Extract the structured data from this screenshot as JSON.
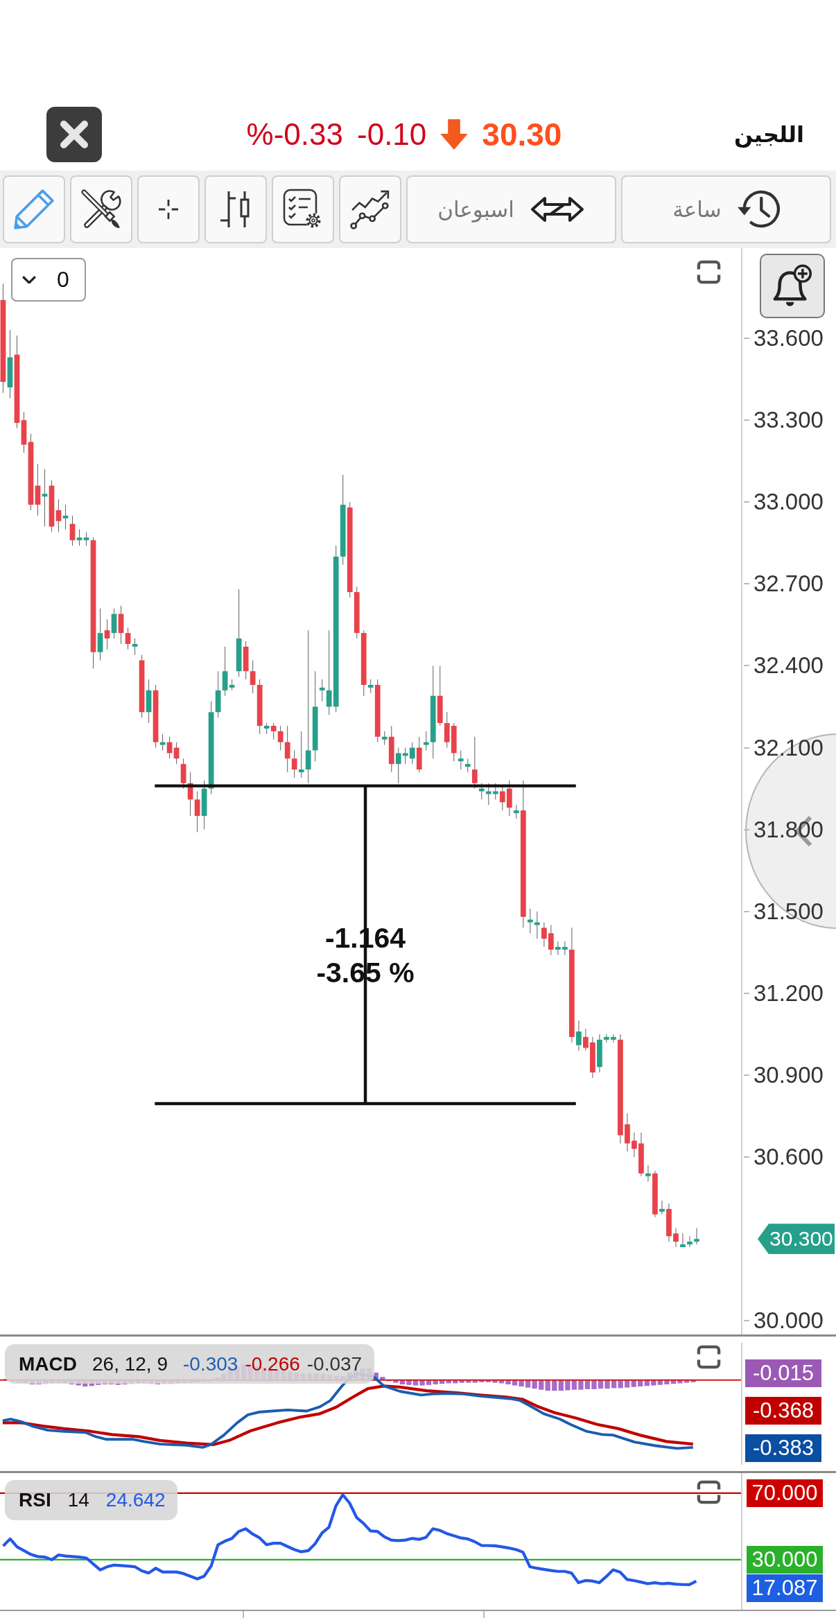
{
  "header": {
    "symbol": "اللجين",
    "price": "30.30",
    "falling": true,
    "change": "-0.10",
    "change_percent": "%-0.33"
  },
  "toolbar": {
    "period_button": {
      "label": "اسبوعان"
    },
    "interval_button": {
      "label": "ساعة"
    }
  },
  "chart": {
    "layer_selector": {
      "value": "0"
    },
    "last_price_tag": "30.300",
    "measurement": {
      "change": "-1.164",
      "change_percent": "-3.65 %"
    },
    "chart_data": {
      "type": "candlestick",
      "ylim": [
        29.95,
        33.93
      ],
      "yticks": [
        {
          "value": 33.6,
          "label": "33.600"
        },
        {
          "value": 33.3,
          "label": "33.300"
        },
        {
          "value": 33.0,
          "label": "33.000"
        },
        {
          "value": 32.7,
          "label": "32.700"
        },
        {
          "value": 32.4,
          "label": "32.400"
        },
        {
          "value": 32.1,
          "label": "32.100"
        },
        {
          "value": 31.8,
          "label": "31.800"
        },
        {
          "value": 31.5,
          "label": "31.500"
        },
        {
          "value": 31.2,
          "label": "31.200"
        },
        {
          "value": 30.9,
          "label": "30.900"
        },
        {
          "value": 30.6,
          "label": "30.600"
        },
        {
          "value": 30.0,
          "label": "30.000"
        }
      ],
      "ohlc": [
        [
          33.74,
          33.8,
          33.4,
          33.44
        ],
        [
          33.42,
          33.63,
          33.38,
          33.53
        ],
        [
          33.54,
          33.61,
          33.27,
          33.29
        ],
        [
          33.3,
          33.33,
          33.18,
          33.21
        ],
        [
          33.22,
          33.25,
          32.97,
          32.99
        ],
        [
          33.06,
          33.14,
          32.95,
          32.99
        ],
        [
          33.02,
          33.12,
          32.91,
          33.03
        ],
        [
          33.06,
          33.08,
          32.89,
          32.91
        ],
        [
          32.97,
          33.01,
          32.89,
          32.93
        ],
        [
          32.94,
          32.99,
          32.9,
          32.95
        ],
        [
          32.92,
          32.95,
          32.84,
          32.86
        ],
        [
          32.86,
          32.9,
          32.84,
          32.87
        ],
        [
          32.86,
          32.89,
          32.84,
          32.87
        ],
        [
          32.86,
          32.87,
          32.39,
          32.45
        ],
        [
          32.45,
          32.61,
          32.42,
          32.52
        ],
        [
          32.53,
          32.57,
          32.46,
          32.5
        ],
        [
          32.52,
          32.61,
          32.5,
          32.59
        ],
        [
          32.59,
          32.62,
          32.48,
          32.52
        ],
        [
          32.52,
          32.54,
          32.46,
          32.48
        ],
        [
          32.47,
          32.5,
          32.44,
          32.48
        ],
        [
          32.42,
          32.44,
          32.21,
          32.23
        ],
        [
          32.23,
          32.35,
          32.19,
          32.31
        ],
        [
          32.31,
          32.33,
          32.1,
          32.12
        ],
        [
          32.11,
          32.15,
          32.09,
          32.12
        ],
        [
          32.12,
          32.14,
          32.06,
          32.08
        ],
        [
          32.1,
          32.12,
          32.04,
          32.06
        ],
        [
          32.04,
          32.06,
          31.95,
          31.97
        ],
        [
          31.97,
          32.01,
          31.85,
          31.91
        ],
        [
          31.91,
          31.94,
          31.79,
          31.85
        ],
        [
          31.85,
          31.98,
          31.8,
          31.95
        ],
        [
          31.95,
          32.27,
          31.93,
          32.23
        ],
        [
          32.23,
          32.38,
          32.21,
          32.31
        ],
        [
          32.31,
          32.47,
          32.29,
          32.38
        ],
        [
          32.32,
          32.35,
          32.31,
          32.33
        ],
        [
          32.38,
          32.68,
          32.36,
          32.5
        ],
        [
          32.47,
          32.49,
          32.35,
          32.38
        ],
        [
          32.38,
          32.42,
          32.3,
          32.33
        ],
        [
          32.33,
          32.35,
          32.15,
          32.18
        ],
        [
          32.17,
          32.19,
          32.15,
          32.18
        ],
        [
          32.18,
          32.19,
          32.13,
          32.16
        ],
        [
          32.16,
          32.18,
          32.09,
          32.12
        ],
        [
          32.12,
          32.18,
          32.01,
          32.06
        ],
        [
          32.06,
          32.09,
          31.99,
          32.02
        ],
        [
          32.01,
          32.16,
          31.99,
          32.02
        ],
        [
          32.02,
          32.53,
          31.97,
          32.09
        ],
        [
          32.09,
          32.38,
          32.05,
          32.25
        ],
        [
          32.31,
          32.35,
          32.27,
          32.32
        ],
        [
          32.25,
          32.53,
          32.22,
          32.31
        ],
        [
          32.25,
          32.84,
          32.23,
          32.8
        ],
        [
          32.8,
          33.1,
          32.77,
          32.99
        ],
        [
          32.98,
          33.0,
          32.65,
          32.67
        ],
        [
          32.67,
          32.69,
          32.5,
          32.52
        ],
        [
          32.52,
          32.53,
          32.29,
          32.33
        ],
        [
          32.32,
          32.35,
          32.3,
          32.33
        ],
        [
          32.33,
          32.35,
          32.12,
          32.14
        ],
        [
          32.13,
          32.16,
          32.11,
          32.14
        ],
        [
          32.14,
          32.18,
          32.01,
          32.04
        ],
        [
          32.04,
          32.1,
          31.97,
          32.08
        ],
        [
          32.07,
          32.1,
          32.04,
          32.08
        ],
        [
          32.06,
          32.12,
          32.04,
          32.1
        ],
        [
          32.1,
          32.14,
          32.01,
          32.02
        ],
        [
          32.11,
          32.16,
          32.09,
          32.12
        ],
        [
          32.12,
          32.4,
          32.06,
          32.29
        ],
        [
          32.29,
          32.4,
          32.18,
          32.19
        ],
        [
          32.19,
          32.23,
          32.1,
          32.12
        ],
        [
          32.18,
          32.19,
          32.05,
          32.08
        ],
        [
          32.05,
          32.09,
          32.02,
          32.06
        ],
        [
          32.03,
          32.06,
          32.01,
          32.04
        ],
        [
          32.02,
          32.14,
          31.95,
          31.97
        ],
        [
          31.94,
          31.97,
          31.91,
          31.95
        ],
        [
          31.93,
          31.97,
          31.89,
          31.94
        ],
        [
          31.93,
          31.97,
          31.91,
          31.94
        ],
        [
          31.94,
          31.96,
          31.87,
          31.9
        ],
        [
          31.95,
          31.98,
          31.85,
          31.88
        ],
        [
          31.86,
          31.89,
          31.84,
          31.87
        ],
        [
          31.87,
          31.98,
          31.44,
          31.48
        ],
        [
          31.46,
          31.51,
          31.42,
          31.47
        ],
        [
          31.45,
          31.5,
          31.4,
          31.46
        ],
        [
          31.44,
          31.46,
          31.37,
          31.4
        ],
        [
          31.42,
          31.45,
          31.34,
          31.36
        ],
        [
          31.36,
          31.39,
          31.34,
          31.37
        ],
        [
          31.36,
          31.39,
          31.34,
          31.37
        ],
        [
          31.36,
          31.44,
          31.02,
          31.04
        ],
        [
          31.01,
          31.1,
          30.99,
          31.06
        ],
        [
          31.04,
          31.07,
          30.99,
          31.0
        ],
        [
          31.02,
          31.04,
          30.89,
          30.91
        ],
        [
          30.93,
          31.05,
          30.91,
          31.03
        ],
        [
          31.03,
          31.05,
          31.02,
          31.04
        ],
        [
          31.03,
          31.05,
          31.02,
          31.04
        ],
        [
          31.03,
          31.05,
          30.65,
          30.68
        ],
        [
          30.72,
          30.76,
          30.62,
          30.65
        ],
        [
          30.66,
          30.69,
          30.6,
          30.63
        ],
        [
          30.65,
          30.69,
          30.53,
          30.54
        ],
        [
          30.53,
          30.57,
          30.51,
          30.54
        ],
        [
          30.54,
          30.55,
          30.38,
          30.39
        ],
        [
          30.4,
          30.44,
          30.39,
          30.41
        ],
        [
          30.41,
          30.43,
          30.29,
          30.31
        ],
        [
          30.32,
          30.34,
          30.27,
          30.29
        ],
        [
          30.27,
          30.32,
          30.27,
          30.28
        ],
        [
          30.28,
          30.31,
          30.27,
          30.29
        ],
        [
          30.29,
          30.34,
          30.28,
          30.3
        ]
      ],
      "ref_lines": [
        {
          "axis": "y",
          "value": 31.96,
          "color": "#111111"
        },
        {
          "axis": "y",
          "value": 30.796,
          "color": "#111111"
        }
      ]
    }
  },
  "macd": {
    "name": "MACD",
    "params": "26, 12, 9",
    "values": [
      {
        "text": "-0.303",
        "color": "#1f5fb4"
      },
      {
        "text": "-0.266",
        "color": "#c00000"
      },
      {
        "text": "-0.037",
        "color": "#333333"
      }
    ],
    "tags": [
      {
        "text": "-0.015",
        "color": "#9b59b6"
      },
      {
        "text": "-0.368",
        "color": "#c00000"
      },
      {
        "text": "-0.383",
        "color": "#0b4ea2"
      }
    ]
  },
  "rsi": {
    "params": "14",
    "value": "24.642",
    "current_tag": "17.087",
    "chart_data": {
      "type": "line",
      "ylim": [
        0,
        82
      ],
      "yticks": [
        {
          "value": 30,
          "label": "30.000"
        },
        {
          "value": 70,
          "label": "70.000"
        }
      ],
      "ref_lines": [
        {
          "axis": "y",
          "value": 70,
          "color": "#cc0000"
        },
        {
          "axis": "y",
          "value": 30,
          "color": "#2bb02b"
        }
      ],
      "series": [
        {
          "name": "RSI",
          "color": "#2458e6",
          "values": [
            38.3,
            42.5,
            37.7,
            35.4,
            33.2,
            31.9,
            31.6,
            30.0,
            32.9,
            32.2,
            31.9,
            31.6,
            31.0,
            27.4,
            23.9,
            25.8,
            26.8,
            26.5,
            26.2,
            25.8,
            23.3,
            22.0,
            24.9,
            22.6,
            22.6,
            22.6,
            21.7,
            20.1,
            18.5,
            20.1,
            26.2,
            39.0,
            41.2,
            42.8,
            47.0,
            48.6,
            45.4,
            43.1,
            39.0,
            39.9,
            39.9,
            38.0,
            36.1,
            34.8,
            35.4,
            39.6,
            46.0,
            49.5,
            62.3,
            69.0,
            63.9,
            55.3,
            51.8,
            47.3,
            47.0,
            43.8,
            41.8,
            41.5,
            41.8,
            42.8,
            42.2,
            43.4,
            48.6,
            47.6,
            45.7,
            44.4,
            43.1,
            42.5,
            40.9,
            38.6,
            38.5,
            38.3,
            37.7,
            37.0,
            36.1,
            34.5,
            25.8,
            24.9,
            24.2,
            23.6,
            23.0,
            23.0,
            22.0,
            16.2,
            17.5,
            17.2,
            16.2,
            19.8,
            23.9,
            22.6,
            18.2,
            17.5,
            16.6,
            15.6,
            16.2,
            15.6,
            15.9,
            15.3,
            15.1,
            15.0,
            17.1
          ]
        }
      ]
    }
  }
}
